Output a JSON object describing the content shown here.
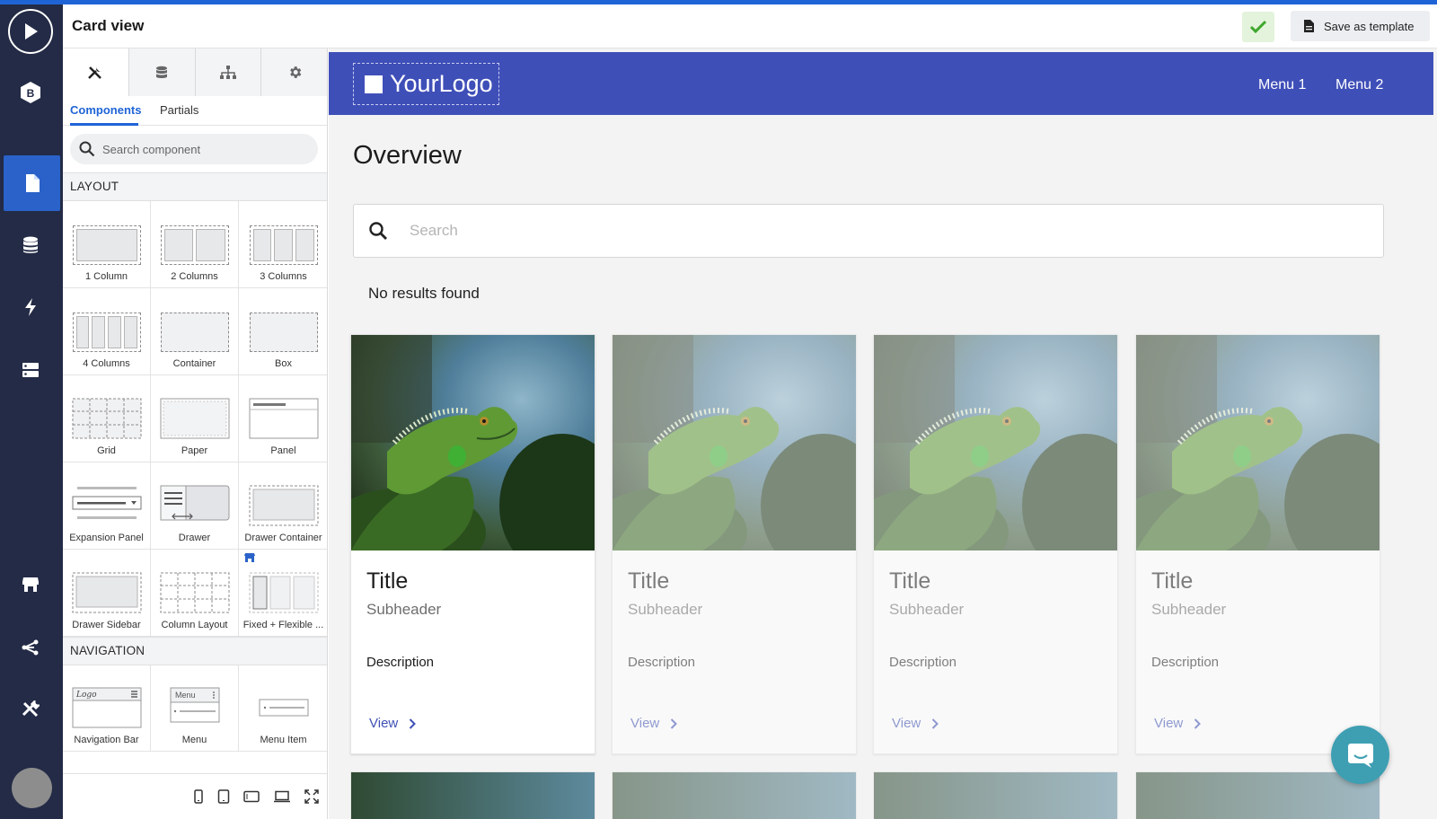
{
  "app": {
    "accent_color": "#1f64d6",
    "rail_color": "#232b46",
    "appbar_color": "#3f4fb8"
  },
  "rail": {
    "items": [
      {
        "name": "play",
        "icon": "play-icon"
      },
      {
        "name": "brand",
        "icon": "b-badge-icon",
        "label": "B"
      },
      {
        "name": "pages",
        "icon": "page-icon",
        "active": true
      },
      {
        "name": "data",
        "icon": "database-icon"
      },
      {
        "name": "actions",
        "icon": "lightning-icon"
      },
      {
        "name": "servers",
        "icon": "server-icon"
      },
      {
        "name": "store",
        "icon": "store-icon"
      },
      {
        "name": "share",
        "icon": "share-icon"
      },
      {
        "name": "tools",
        "icon": "tools-icon"
      }
    ]
  },
  "header": {
    "title": "Card view",
    "save_template_label": "Save as template"
  },
  "panel": {
    "top_tabs": [
      {
        "icon": "tools-icon",
        "active": true
      },
      {
        "icon": "database-icon"
      },
      {
        "icon": "hierarchy-icon"
      },
      {
        "icon": "gear-icon"
      }
    ],
    "sub_tabs": {
      "components": "Components",
      "partials": "Partials"
    },
    "search_placeholder": "Search component",
    "layout_heading": "LAYOUT",
    "layout_items": [
      "1 Column",
      "2 Columns",
      "3 Columns",
      "4 Columns",
      "Container",
      "Box",
      "Grid",
      "Paper",
      "Panel",
      "Expansion Panel",
      "Drawer",
      "Drawer Container",
      "Drawer Sidebar",
      "Column Layout",
      "Fixed + Flexible ..."
    ],
    "navigation_heading": "NAVIGATION",
    "navigation_items": [
      "Navigation Bar",
      "Menu",
      "Menu Item"
    ],
    "nav_thumb_text": {
      "logo": "Logo",
      "menu": "Menu"
    }
  },
  "preview": {
    "logo_your": "Your",
    "logo_logo": "Logo",
    "menu_1": "Menu 1",
    "menu_2": "Menu 2",
    "page_heading": "Overview",
    "search_placeholder": "Search",
    "empty_message": "No results found",
    "cards": [
      {
        "title": "Title",
        "subheader": "Subheader",
        "description": "Description",
        "action": "View"
      },
      {
        "title": "Title",
        "subheader": "Subheader",
        "description": "Description",
        "action": "View"
      },
      {
        "title": "Title",
        "subheader": "Subheader",
        "description": "Description",
        "action": "View"
      },
      {
        "title": "Title",
        "subheader": "Subheader",
        "description": "Description",
        "action": "View"
      }
    ]
  }
}
